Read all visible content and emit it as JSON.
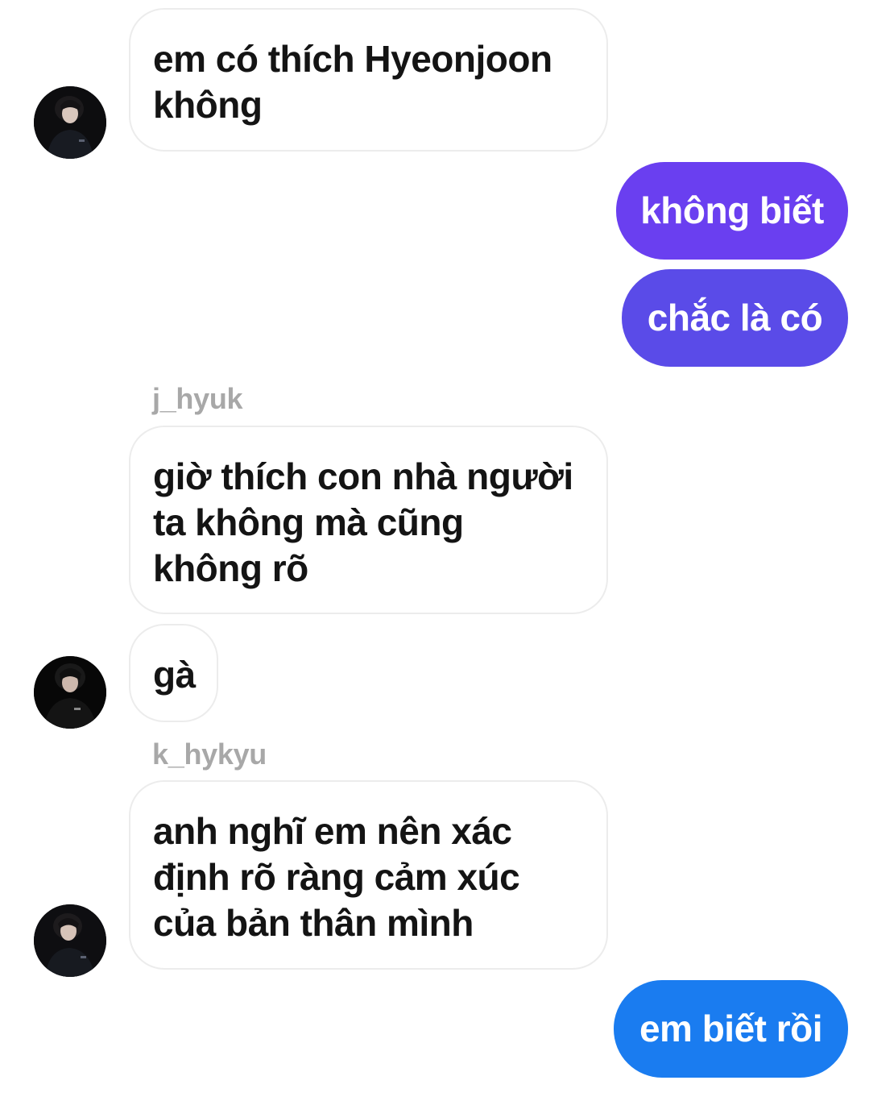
{
  "colors": {
    "sent_purple": "#6a3ff0",
    "sent_violet": "#5a4be8",
    "sent_blue": "#1a7cf0",
    "received_bg": "#ffffff",
    "received_border": "#ececec",
    "sender_name": "#a8a8a8"
  },
  "messages": [
    {
      "direction": "received",
      "lines": [
        "em có thích Hyeonjoon",
        "không"
      ]
    },
    {
      "direction": "sent",
      "text": "không biết"
    },
    {
      "direction": "sent",
      "text": "chắc là có"
    },
    {
      "direction": "received",
      "sender": "j_hyuk",
      "lines": [
        "giờ thích con nhà người",
        "ta không mà cũng",
        "không rõ"
      ]
    },
    {
      "direction": "received",
      "lines": [
        "gà"
      ]
    },
    {
      "direction": "received",
      "sender": "k_hykyu",
      "lines": [
        "anh nghĩ em nên xác",
        "định rõ ràng cảm xúc",
        "của bản thân mình"
      ]
    },
    {
      "direction": "sent",
      "text": "em biết rồi"
    }
  ],
  "avatars": [
    "profile-photo",
    "profile-photo",
    "profile-photo"
  ]
}
